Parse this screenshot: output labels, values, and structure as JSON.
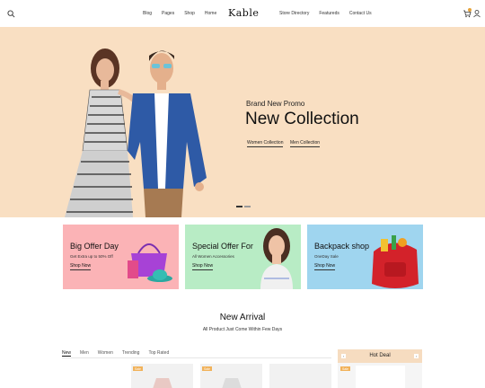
{
  "header": {
    "logo": "Kable",
    "nav_left": [
      "Blog",
      "Pages",
      "Shop",
      "Home"
    ],
    "nav_right": [
      "Store Directory",
      "Featureds",
      "Contact Us"
    ],
    "icons": [
      "search-icon",
      "cart-icon",
      "user-icon"
    ]
  },
  "hero": {
    "subtitle": "Brand New Promo",
    "title": "New Collection",
    "links": [
      "Women Collection",
      "Men Collection"
    ],
    "background": "#f9dfc2",
    "slides": 2,
    "active_slide": 1
  },
  "offers": [
    {
      "title": "Big Offer Day",
      "subtitle": "Get Extra up to 50% Off",
      "link": "Shop Now",
      "color": "#fbb3b6"
    },
    {
      "title": "Special Offer For",
      "subtitle": "All Women Accessories",
      "link": "Shop Now",
      "color": "#b8ecc5"
    },
    {
      "title": "Backpack shop",
      "subtitle": "OneDay Sale",
      "link": "Shop Now",
      "color": "#9fd5ef"
    }
  ],
  "new_arrival": {
    "title": "New Arrival",
    "subtitle": "All Product Just Come Within Few Days",
    "tabs": [
      "New",
      "Men",
      "Women",
      "Trending",
      "Top Rated"
    ],
    "active_tab": "New",
    "product_tags": [
      "Sale",
      "Sale",
      ""
    ]
  },
  "hot_deal": {
    "label": "Hot Deal",
    "prev": "‹",
    "next": "›",
    "tag": "Sale"
  },
  "colors": {
    "accent": "#f1b25a",
    "hero_bg": "#f9dfc2"
  }
}
